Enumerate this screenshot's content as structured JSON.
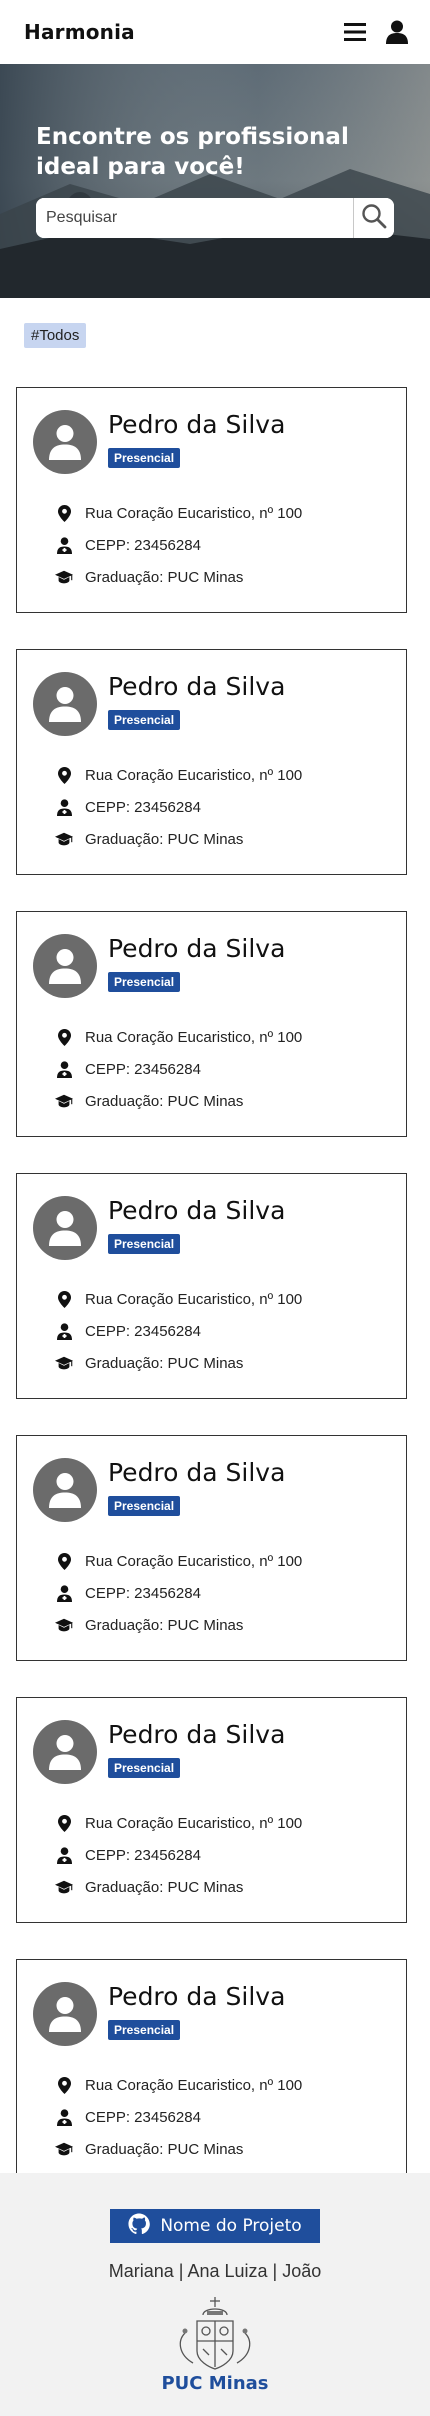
{
  "header": {
    "brand": "Harmonia",
    "menu_icon": "menu-icon",
    "profile_icon": "user-icon"
  },
  "hero": {
    "title": "Encontre os profissional ideal para você!",
    "search_placeholder": "Pesquisar",
    "search_icon": "search-icon"
  },
  "filters": {
    "active_tag": "#Todos"
  },
  "colors": {
    "accent": "#1f4e9c",
    "tag_bg": "#c7d5f0",
    "avatar_bg": "#6b6b6b",
    "footer_bg": "#f2f2f2"
  },
  "cards": [
    {
      "name": "Pedro da Silva",
      "badge": "Presencial",
      "address": "Rua Coração Eucaristico, nº 100",
      "cepp": "CEPP: 23456284",
      "graduation": "Graduação: PUC Minas"
    },
    {
      "name": "Pedro da Silva",
      "badge": "Presencial",
      "address": "Rua Coração Eucaristico, nº 100",
      "cepp": "CEPP: 23456284",
      "graduation": "Graduação: PUC Minas"
    },
    {
      "name": "Pedro da Silva",
      "badge": "Presencial",
      "address": "Rua Coração Eucaristico, nº 100",
      "cepp": "CEPP: 23456284",
      "graduation": "Graduação: PUC Minas"
    },
    {
      "name": "Pedro da Silva",
      "badge": "Presencial",
      "address": "Rua Coração Eucaristico, nº 100",
      "cepp": "CEPP: 23456284",
      "graduation": "Graduação: PUC Minas"
    },
    {
      "name": "Pedro da Silva",
      "badge": "Presencial",
      "address": "Rua Coração Eucaristico, nº 100",
      "cepp": "CEPP: 23456284",
      "graduation": "Graduação: PUC Minas"
    },
    {
      "name": "Pedro da Silva",
      "badge": "Presencial",
      "address": "Rua Coração Eucaristico, nº 100",
      "cepp": "CEPP: 23456284",
      "graduation": "Graduação: PUC Minas"
    },
    {
      "name": "Pedro da Silva",
      "badge": "Presencial",
      "address": "Rua Coração Eucaristico, nº 100",
      "cepp": "CEPP: 23456284",
      "graduation": "Graduação: PUC Minas"
    }
  ],
  "footer": {
    "project_button": "Nome do Projeto",
    "project_icon": "github-icon",
    "authors": "Mariana | Ana Luiza | João",
    "logo_text": "PUC Minas"
  }
}
